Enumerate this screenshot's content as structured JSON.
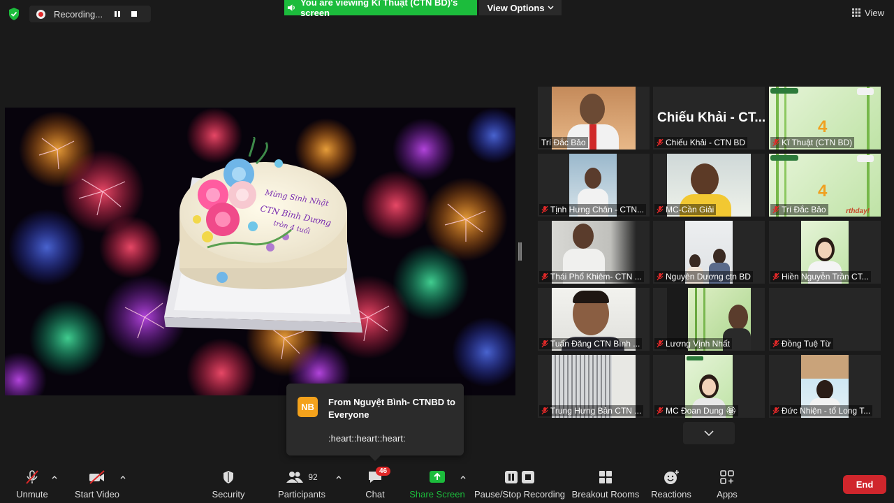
{
  "top": {
    "recording_label": "Recording...",
    "viewing_banner": "You are viewing Kĩ Thuật (CTN BD)'s screen",
    "view_options": "View Options",
    "view": "View"
  },
  "share": {
    "cake_text_line1": "Mừng Sinh Nhật",
    "cake_text_line2": "CTN Bình Dương",
    "cake_text_line3": "tròn 4 tuổi"
  },
  "gallery": {
    "tiles": [
      {
        "name": "Trí Đắc Bảo",
        "muted": false
      },
      {
        "name": "Chiếu Khải - CTN BD",
        "muted": true,
        "display_name": "Chiếu Khải - CT..."
      },
      {
        "name": "Kĩ Thuật (CTN BD)",
        "muted": true,
        "overlay_text": "4"
      },
      {
        "name": "Tịnh Hưng Chân - CTN...",
        "muted": true
      },
      {
        "name": "MC-Cần Giải",
        "muted": true
      },
      {
        "name": "Trí Đắc Bảo",
        "muted": true,
        "overlay_text": "4",
        "overlay_banner": "rthday!"
      },
      {
        "name": "Thái Phổ Khiêm- CTN ...",
        "muted": true
      },
      {
        "name": "Nguyên Dương ctn BD",
        "muted": true
      },
      {
        "name": "Hiền Nguyễn Trần CT...",
        "muted": true
      },
      {
        "name": "Tuấn Đăng CTN Bình ...",
        "muted": true
      },
      {
        "name": "Lương Vịnh Nhất",
        "muted": true
      },
      {
        "name": "Đồng Tuệ Từ",
        "muted": true
      },
      {
        "name": "Trung Hưng Bản CTN ...",
        "muted": true
      },
      {
        "name": "MC Đoan Dung 🏵",
        "muted": true
      },
      {
        "name": "Đức Nhiện - tổ Long T...",
        "muted": true
      }
    ]
  },
  "chat_toast": {
    "avatar": "NB",
    "from": "From Nguyệt Bình- CTNBD to Everyone",
    "message": ":heart::heart::heart:"
  },
  "toolbar": {
    "unmute": "Unmute",
    "start_video": "Start Video",
    "security": "Security",
    "participants": "Participants",
    "participant_count": "92",
    "chat": "Chat",
    "chat_badge": "46",
    "share_screen": "Share Screen",
    "recording": "Pause/Stop Recording",
    "breakout": "Breakout Rooms",
    "reactions": "Reactions",
    "apps": "Apps",
    "end": "End"
  },
  "colors": {
    "green": "#1cbc3c",
    "end_red": "#d0262c",
    "toast_avatar": "#f4a21c",
    "badge_red": "#e02828"
  }
}
